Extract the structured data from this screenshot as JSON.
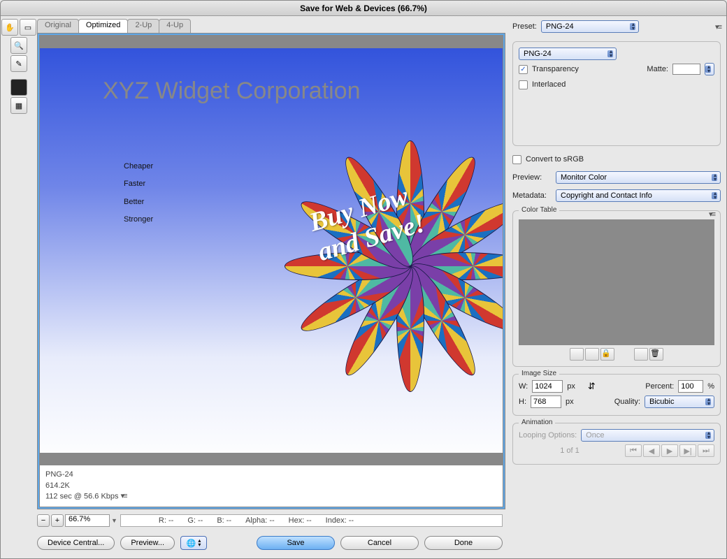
{
  "window": {
    "title": "Save for Web & Devices (66.7%)"
  },
  "tabs": [
    "Original",
    "Optimized",
    "2-Up",
    "4-Up"
  ],
  "active_tab": 1,
  "canvas": {
    "heading": "XYZ Widget Corporation",
    "bullets": [
      "Cheaper",
      "Faster",
      "Better",
      "Stronger"
    ],
    "promo": "Buy Now\nand Save!"
  },
  "info": {
    "format": "PNG-24",
    "size": "614.2K",
    "timing": "112 sec @ 56.6 Kbps"
  },
  "zoom": {
    "value": "66.7%"
  },
  "status": {
    "r": "R: --",
    "g": "G: --",
    "b": "B: --",
    "alpha": "Alpha: --",
    "hex": "Hex: --",
    "index": "Index: --"
  },
  "bottom": {
    "device_central": "Device Central...",
    "preview": "Preview...",
    "save": "Save",
    "cancel": "Cancel",
    "done": "Done"
  },
  "preset": {
    "label": "Preset:",
    "value": "PNG-24"
  },
  "format": {
    "value": "PNG-24"
  },
  "transparency": {
    "label": "Transparency",
    "checked": true
  },
  "interlaced": {
    "label": "Interlaced",
    "checked": false
  },
  "matte": {
    "label": "Matte:"
  },
  "convert_srgb": {
    "label": "Convert to sRGB",
    "checked": false
  },
  "preview_mode": {
    "label": "Preview:",
    "value": "Monitor Color"
  },
  "metadata": {
    "label": "Metadata:",
    "value": "Copyright and Contact Info"
  },
  "color_table": {
    "title": "Color Table"
  },
  "image_size": {
    "title": "Image Size",
    "w_label": "W:",
    "w": "1024",
    "h_label": "H:",
    "h": "768",
    "unit": "px",
    "percent_label": "Percent:",
    "percent": "100",
    "percent_unit": "%",
    "quality_label": "Quality:",
    "quality": "Bicubic"
  },
  "animation": {
    "title": "Animation",
    "looping_label": "Looping Options:",
    "looping": "Once",
    "page": "1 of 1"
  }
}
